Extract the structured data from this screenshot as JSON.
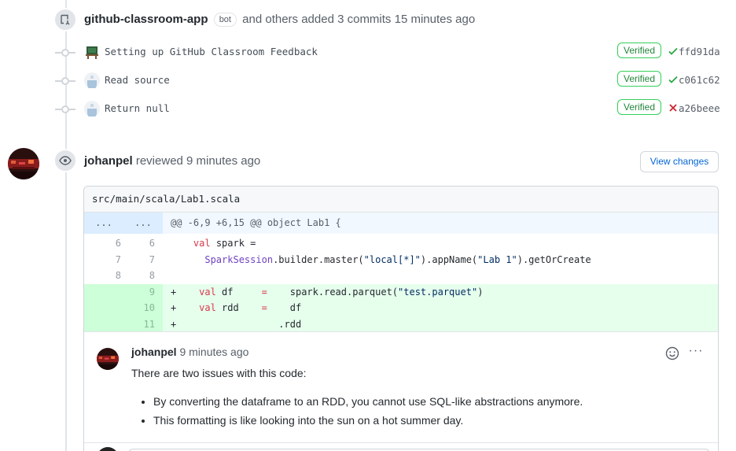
{
  "push_event": {
    "author": "github-classroom-app",
    "bot_label": "bot",
    "action_text": "and others added 3 commits",
    "time": "15 minutes ago"
  },
  "commits": [
    {
      "message": "Setting up GitHub Classroom Feedback",
      "verified_label": "Verified",
      "status": "success",
      "sha": "ffd91da",
      "avatar_icon": "classroom-avatar-icon"
    },
    {
      "message": "Read source",
      "verified_label": "Verified",
      "status": "success",
      "sha": "c061c62",
      "avatar_icon": "default-avatar-icon"
    },
    {
      "message": "Return null",
      "verified_label": "Verified",
      "status": "failure",
      "sha": "a26beee",
      "avatar_icon": "default-avatar-icon"
    }
  ],
  "review": {
    "author": "johanpel",
    "action_text": "reviewed",
    "time": "9 minutes ago",
    "view_changes_label": "View changes"
  },
  "file": {
    "path": "src/main/scala/Lab1.scala",
    "hunk": {
      "left": "...",
      "right": "...",
      "text": "@@ -6,9 +6,15 @@ object Lab1 {"
    },
    "lines": [
      {
        "old": "6",
        "new": "6",
        "type": "context"
      },
      {
        "old": "7",
        "new": "7",
        "type": "context"
      },
      {
        "old": "8",
        "new": "8",
        "type": "context"
      },
      {
        "old": "",
        "new": "9",
        "type": "added"
      },
      {
        "old": "",
        "new": "10",
        "type": "added"
      },
      {
        "old": "",
        "new": "11",
        "type": "added"
      }
    ],
    "code": {
      "l1_kw": "val",
      "l1_rest": " spark =",
      "l2_cls": "SparkSession",
      "l2_a": ".builder.master(",
      "l2_str1": "\"local[*]\"",
      "l2_b": ").appName(",
      "l2_str2": "\"Lab 1\"",
      "l2_c": ").getOrCreate",
      "l4_kw": "val",
      "l4_a": " df     ",
      "l4_op": "=",
      "l4_b": "    spark.read.parquet(",
      "l4_str": "\"test.parquet\"",
      "l4_c": ")",
      "l5_kw": "val",
      "l5_a": " rdd    ",
      "l5_op": "=",
      "l5_b": "    df",
      "l6": "                  .rdd",
      "plus": "+"
    }
  },
  "comment": {
    "author": "johanpel",
    "time": "9 minutes ago",
    "body_intro": "There are two issues with this code:",
    "bullets": [
      "By converting the dataframe to an RDD, you cannot use SQL-like abstractions anymore.",
      "This formatting is like looking into the sun on a hot summer day."
    ],
    "more_label": "···"
  },
  "colors": {
    "accent": "#0366d6",
    "verified_green": "#22863a",
    "failure_red": "#cb2431",
    "added_bg": "#e6ffed",
    "hunk_bg": "#f1f8ff"
  }
}
